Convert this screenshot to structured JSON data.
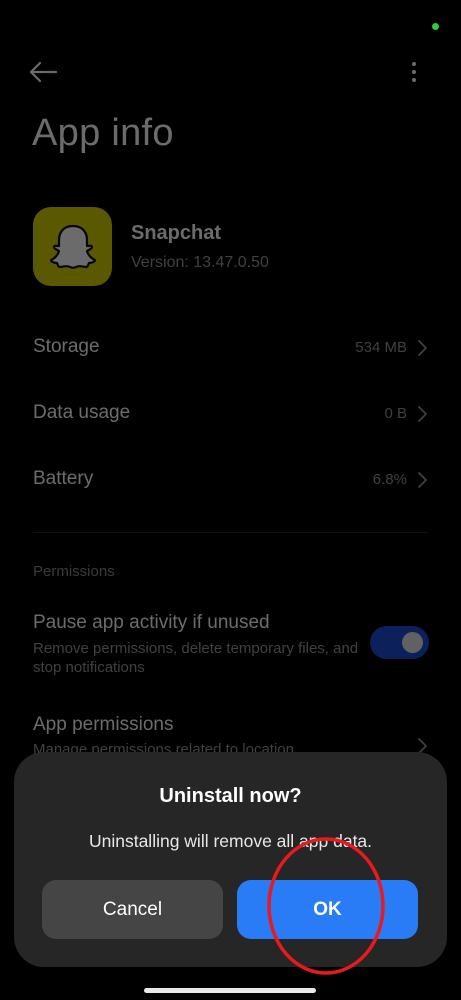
{
  "header": {
    "back_icon": "arrow-left-icon",
    "more_icon": "vertical-dots-icon",
    "title": "App info"
  },
  "app": {
    "name": "Snapchat",
    "version": "Version: 13.47.0.50",
    "icon": "snapchat-ghost-icon",
    "icon_color": "#d6d200"
  },
  "rows": [
    {
      "label": "Storage",
      "value": "534 MB"
    },
    {
      "label": "Data usage",
      "value": "0 B"
    },
    {
      "label": "Battery",
      "value": "6.8%"
    }
  ],
  "permissions": {
    "section_header": "Permissions",
    "pause": {
      "title": "Pause app activity if unused",
      "description": "Remove permissions, delete temporary files, and stop notifications",
      "toggle_on": true
    },
    "app_permissions": {
      "title": "App permissions",
      "description": "Manage permissions related to location,"
    }
  },
  "dialog": {
    "title": "Uninstall now?",
    "message": "Uninstalling will remove all app data.",
    "cancel_label": "Cancel",
    "ok_label": "OK"
  },
  "colors": {
    "accent": "#2a7cf6",
    "toggle": "#1d4fd8",
    "annotation": "#e8191f",
    "status_dot": "#2ecc40"
  }
}
